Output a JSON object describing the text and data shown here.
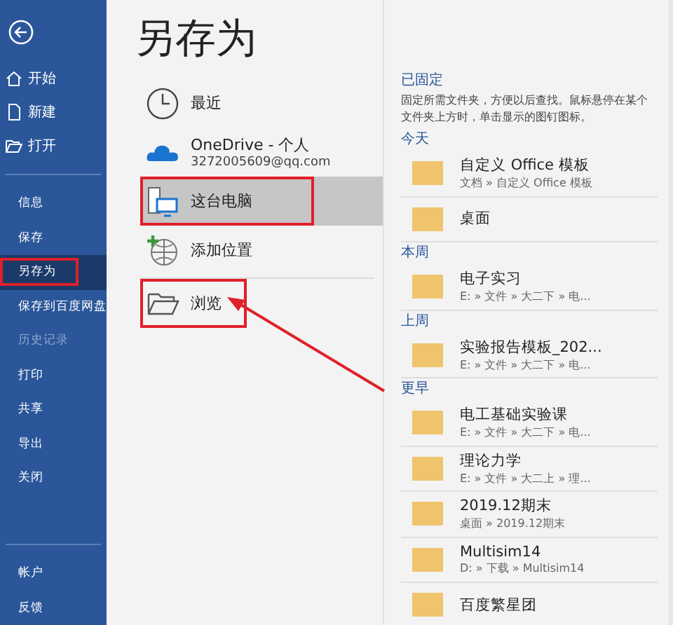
{
  "sidebar": {
    "top_items": [
      {
        "label": "开始"
      },
      {
        "label": "新建"
      },
      {
        "label": "打开"
      }
    ],
    "items": [
      {
        "label": "信息",
        "selected": false,
        "disabled": false,
        "annotated": false
      },
      {
        "label": "保存",
        "selected": false,
        "disabled": false,
        "annotated": false
      },
      {
        "label": "另存为",
        "selected": true,
        "disabled": false,
        "annotated": true
      },
      {
        "label": "保存到百度网盘",
        "selected": false,
        "disabled": false,
        "annotated": false
      },
      {
        "label": "历史记录",
        "selected": false,
        "disabled": true,
        "annotated": false
      },
      {
        "label": "打印",
        "selected": false,
        "disabled": false,
        "annotated": false
      },
      {
        "label": "共享",
        "selected": false,
        "disabled": false,
        "annotated": false
      },
      {
        "label": "导出",
        "selected": false,
        "disabled": false,
        "annotated": false
      },
      {
        "label": "关闭",
        "selected": false,
        "disabled": false,
        "annotated": false
      }
    ],
    "bottom_items": [
      {
        "label": "帐户",
        "selected": false,
        "disabled": false,
        "annotated": false
      },
      {
        "label": "反馈",
        "selected": false,
        "disabled": false,
        "annotated": false
      }
    ]
  },
  "page_title": "另存为",
  "locations": [
    {
      "kind": "recent",
      "label": "最近",
      "selected": false,
      "annotated": false
    },
    {
      "kind": "onedrive",
      "label": "OneDrive - 个人",
      "detail": "3272005609@qq.com",
      "selected": false,
      "annotated": false
    },
    {
      "kind": "pc",
      "label": "这台电脑",
      "selected": true,
      "annotated": true
    },
    {
      "kind": "add",
      "label": "添加位置",
      "selected": false,
      "annotated": false
    },
    {
      "kind": "browse",
      "label": "浏览",
      "selected": false,
      "annotated": true
    }
  ],
  "folders": {
    "pinned_title": "已固定",
    "pinned_hint": "固定所需文件夹，方便以后查找。鼠标悬停在某个文件夹上方时，单击显示的图钉图标。",
    "groups": [
      {
        "title": "今天",
        "items": [
          {
            "name": "自定义 Office 模板",
            "path": "文档 » 自定义 Office 模板"
          },
          {
            "name": "桌面"
          }
        ]
      },
      {
        "title": "本周",
        "items": [
          {
            "name": "电子实习",
            "path": "E: » 文件 » 大二下 » 电..."
          }
        ]
      },
      {
        "title": "上周",
        "items": [
          {
            "name": "实验报告模板_202...",
            "path": "E: » 文件 » 大二下 » 电..."
          }
        ]
      },
      {
        "title": "更早",
        "items": [
          {
            "name": "电工基础实验课",
            "path": "E: » 文件 » 大二下 » 电..."
          },
          {
            "name": "理论力学",
            "path": "E: » 文件 » 大二上 » 理..."
          },
          {
            "name": "2019.12期末",
            "path": "桌面 » 2019.12期末"
          },
          {
            "name": "Multisim14",
            "path": "D: » 下载 » Multisim14"
          },
          {
            "name": "百度繁星团"
          }
        ]
      }
    ]
  }
}
